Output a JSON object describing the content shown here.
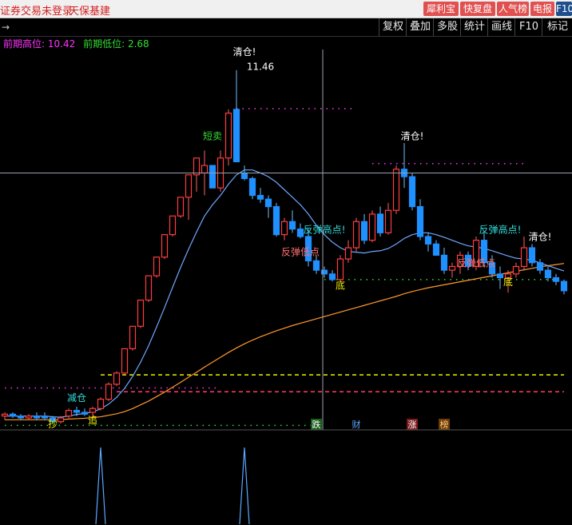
{
  "topbar": {
    "broker_status": "证券交易未登录",
    "stock_name": "天保基建",
    "buttons": [
      {
        "label": "犀利宝",
        "color": "#e05050"
      },
      {
        "label": "快复盘",
        "color": "#e05050"
      },
      {
        "label": "人气榜",
        "color": "#e05050"
      },
      {
        "label": "电报",
        "color": "#e05050"
      },
      {
        "label": "F10",
        "color": "#1e4f8c"
      }
    ]
  },
  "toolbar": {
    "arrow": "→",
    "items": [
      "复权",
      "叠加",
      "多股",
      "统计",
      "画线",
      "F10",
      "标记"
    ]
  },
  "info": {
    "prev_high_label": "前期高位:",
    "prev_high_value": "10.42",
    "prev_low_label": "前期低位:",
    "prev_low_value": "2.68"
  },
  "colors": {
    "up": "#ff3c3c",
    "down": "#1e90ff",
    "magenta": "#ff33ff",
    "green": "#33dd33",
    "yellow": "#f0f000",
    "ma_short": "#6fa8ff",
    "ma_long": "#ff9a2e"
  },
  "chart_data": {
    "type": "candlestick",
    "y_range": [
      2.0,
      12.0
    ],
    "crosshair_x_index": 40,
    "crosshair_price": 8.7,
    "candles": [
      [
        2.2,
        2.3,
        2.1,
        2.25
      ],
      [
        2.25,
        2.3,
        2.15,
        2.2
      ],
      [
        2.2,
        2.25,
        2.1,
        2.15
      ],
      [
        2.15,
        2.25,
        2.1,
        2.2
      ],
      [
        2.2,
        2.3,
        2.1,
        2.15
      ],
      [
        2.2,
        2.3,
        2.1,
        2.15
      ],
      [
        2.15,
        2.2,
        2.0,
        2.05
      ],
      [
        2.05,
        2.2,
        2.0,
        2.15
      ],
      [
        2.2,
        2.4,
        2.15,
        2.35
      ],
      [
        2.35,
        2.45,
        2.2,
        2.3
      ],
      [
        2.3,
        2.4,
        2.2,
        2.25
      ],
      [
        2.3,
        2.45,
        2.2,
        2.4
      ],
      [
        2.4,
        2.7,
        2.35,
        2.65
      ],
      [
        2.65,
        3.1,
        2.6,
        3.05
      ],
      [
        3.05,
        3.4,
        3.0,
        3.35
      ],
      [
        3.35,
        4.0,
        3.3,
        4.0
      ],
      [
        4.0,
        4.6,
        3.95,
        4.6
      ],
      [
        4.6,
        5.3,
        4.55,
        5.3
      ],
      [
        5.3,
        5.95,
        5.25,
        5.95
      ],
      [
        5.95,
        6.45,
        5.9,
        6.45
      ],
      [
        6.45,
        7.05,
        6.4,
        7.05
      ],
      [
        7.05,
        7.55,
        7.0,
        7.55
      ],
      [
        7.55,
        8.05,
        7.5,
        8.05
      ],
      [
        8.05,
        8.65,
        7.45,
        8.65
      ],
      [
        8.65,
        9.1,
        8.2,
        9.1
      ],
      [
        8.7,
        9.3,
        8.1,
        8.9
      ],
      [
        8.9,
        8.5,
        8.6,
        8.3
      ],
      [
        8.3,
        9.3,
        8.2,
        9.1
      ],
      [
        9.1,
        10.4,
        8.9,
        10.3
      ],
      [
        10.4,
        11.45,
        9.0,
        9.0
      ],
      [
        8.7,
        8.9,
        8.5,
        8.55
      ],
      [
        8.55,
        8.6,
        8.0,
        8.1
      ],
      [
        8.1,
        8.3,
        7.9,
        8.0
      ],
      [
        8.0,
        8.1,
        7.5,
        7.8
      ],
      [
        7.8,
        7.9,
        7.0,
        7.05
      ],
      [
        7.05,
        7.5,
        6.9,
        7.4
      ],
      [
        7.4,
        7.7,
        7.1,
        7.2
      ],
      [
        7.2,
        7.35,
        6.95,
        7.0
      ],
      [
        7.0,
        7.2,
        6.2,
        6.35
      ],
      [
        6.35,
        6.5,
        6.0,
        6.1
      ],
      [
        6.1,
        6.2,
        5.9,
        6.0
      ],
      [
        6.0,
        6.1,
        5.8,
        5.85
      ],
      [
        5.85,
        6.5,
        5.8,
        6.4
      ],
      [
        6.4,
        6.9,
        6.3,
        6.7
      ],
      [
        6.7,
        7.5,
        6.6,
        7.4
      ],
      [
        7.4,
        7.6,
        6.8,
        6.9
      ],
      [
        6.9,
        7.7,
        6.85,
        7.6
      ],
      [
        7.6,
        7.8,
        7.0,
        7.1
      ],
      [
        7.1,
        7.9,
        7.05,
        7.7
      ],
      [
        7.7,
        8.9,
        7.6,
        8.8
      ],
      [
        8.8,
        9.5,
        8.3,
        8.6
      ],
      [
        8.6,
        8.7,
        7.7,
        7.8
      ],
      [
        7.8,
        8.0,
        6.9,
        7.0
      ],
      [
        7.0,
        7.1,
        6.6,
        6.8
      ],
      [
        6.8,
        6.9,
        6.5,
        6.5
      ],
      [
        6.5,
        6.7,
        6.0,
        6.1
      ],
      [
        6.1,
        6.3,
        5.9,
        6.2
      ],
      [
        6.2,
        6.6,
        6.0,
        6.5
      ],
      [
        6.5,
        6.6,
        6.1,
        6.2
      ],
      [
        6.2,
        7.0,
        6.1,
        6.9
      ],
      [
        6.9,
        7.1,
        6.2,
        6.3
      ],
      [
        6.3,
        6.5,
        5.9,
        6.0
      ],
      [
        6.0,
        6.2,
        5.6,
        5.9
      ],
      [
        5.9,
        6.1,
        5.5,
        6.0
      ],
      [
        6.0,
        6.3,
        5.9,
        6.2
      ],
      [
        6.2,
        7.0,
        6.1,
        6.7
      ],
      [
        6.7,
        6.8,
        6.2,
        6.3
      ],
      [
        6.3,
        6.4,
        6.0,
        6.1
      ],
      [
        6.1,
        6.2,
        5.8,
        5.9
      ],
      [
        5.9,
        6.0,
        5.7,
        5.8
      ],
      [
        5.8,
        5.85,
        5.45,
        5.55
      ]
    ],
    "ma_short": [
      2.2,
      2.2,
      2.2,
      2.2,
      2.2,
      2.2,
      2.18,
      2.17,
      2.2,
      2.24,
      2.27,
      2.31,
      2.39,
      2.52,
      2.7,
      2.94,
      3.26,
      3.64,
      4.08,
      4.58,
      5.1,
      5.64,
      6.17,
      6.66,
      7.12,
      7.55,
      7.85,
      8.1,
      8.4,
      8.65,
      8.78,
      8.78,
      8.7,
      8.6,
      8.45,
      8.25,
      8.05,
      7.85,
      7.6,
      7.3,
      7.05,
      6.85,
      6.7,
      6.6,
      6.58,
      6.56,
      6.6,
      6.62,
      6.68,
      6.8,
      6.95,
      7.05,
      7.1,
      7.1,
      7.05,
      6.98,
      6.9,
      6.82,
      6.75,
      6.72,
      6.68,
      6.62,
      6.55,
      6.48,
      6.42,
      6.4,
      6.36,
      6.3,
      6.22,
      6.15,
      6.08
    ],
    "ma_long": [
      2.1,
      2.1,
      2.1,
      2.1,
      2.1,
      2.1,
      2.1,
      2.1,
      2.12,
      2.13,
      2.14,
      2.16,
      2.18,
      2.22,
      2.26,
      2.32,
      2.4,
      2.5,
      2.6,
      2.72,
      2.84,
      2.97,
      3.1,
      3.24,
      3.37,
      3.51,
      3.64,
      3.77,
      3.9,
      4.02,
      4.13,
      4.23,
      4.32,
      4.4,
      4.48,
      4.55,
      4.62,
      4.68,
      4.74,
      4.8,
      4.86,
      4.92,
      4.98,
      5.04,
      5.1,
      5.16,
      5.22,
      5.28,
      5.34,
      5.4,
      5.47,
      5.53,
      5.58,
      5.63,
      5.67,
      5.71,
      5.75,
      5.79,
      5.83,
      5.87,
      5.91,
      5.95,
      5.99,
      6.03,
      6.07,
      6.11,
      6.15,
      6.19,
      6.22,
      6.25,
      6.28
    ],
    "level_lines": [
      {
        "price": 10.42,
        "color": "#ff33ff",
        "style": "dotted",
        "from_index": 29,
        "to_index": 44
      },
      {
        "price": 8.95,
        "color": "#ff33ff",
        "style": "dotted",
        "from_index": 46,
        "to_index": 65
      },
      {
        "price": 3.3,
        "color": "#f0f000",
        "style": "dashed",
        "from_index": 12,
        "to_index": 70
      },
      {
        "price": 2.85,
        "color": "#ff3c6e",
        "style": "dashed",
        "from_index": 14,
        "to_index": 70
      },
      {
        "price": 2.95,
        "color": "#ff33ff",
        "style": "dotted",
        "from_index": 0,
        "to_index": 27
      },
      {
        "price": 1.95,
        "color": "#33dd33",
        "style": "dotted",
        "from_index": 0,
        "to_index": 39
      },
      {
        "price": 5.85,
        "color": "#33dd33",
        "style": "dotted",
        "from_index": 40,
        "to_index": 70
      }
    ],
    "annotations": [
      {
        "text": "清仓!",
        "index": 30,
        "price": 11.85,
        "color": "#ffffff"
      },
      {
        "text": "11.46",
        "index": 32,
        "price": 11.45,
        "color": "#ffffff"
      },
      {
        "text": "短卖",
        "index": 26,
        "price": 9.6,
        "color": "#33dd33"
      },
      {
        "text": "清仓!",
        "index": 51,
        "price": 9.6,
        "color": "#ffffff"
      },
      {
        "text": "反弹高点!",
        "index": 40,
        "price": 7.1,
        "color": "#33dddd"
      },
      {
        "text": "反弹低点",
        "index": 37,
        "price": 6.5,
        "color": "#ff7070"
      },
      {
        "text": "底",
        "index": 42,
        "price": 5.6,
        "color": "#f0f000"
      },
      {
        "text": "反弹高点!",
        "index": 62,
        "price": 7.1,
        "color": "#33dddd"
      },
      {
        "text": "反弹低点",
        "index": 59,
        "price": 6.2,
        "color": "#ff7070"
      },
      {
        "text": "清仓!",
        "index": 67,
        "price": 6.9,
        "color": "#ffffff"
      },
      {
        "text": "底",
        "index": 63,
        "price": 5.7,
        "color": "#f0f000"
      },
      {
        "text": "减仓",
        "index": 9,
        "price": 2.6,
        "color": "#33dddd"
      },
      {
        "text": "追",
        "index": 11,
        "price": 2.0,
        "color": "#f0f000"
      },
      {
        "text": "抄",
        "index": 6,
        "price": 1.9,
        "color": "#f0f000"
      }
    ],
    "markers": [
      {
        "text": "跌",
        "index": 39,
        "bg": "#1a5c1a",
        "color": "#ffffff"
      },
      {
        "text": "财",
        "index": 44,
        "bg": "#000000",
        "color": "#5aa8ff"
      },
      {
        "text": "涨",
        "index": 51,
        "bg": "#7a1a1a",
        "color": "#ffffff"
      },
      {
        "text": "榜",
        "index": 55,
        "bg": "#6b3a10",
        "color": "#ffcc66"
      }
    ],
    "sub_spikes": [
      {
        "index": 12,
        "value": 1.0
      },
      {
        "index": 30,
        "value": 1.0
      }
    ]
  }
}
